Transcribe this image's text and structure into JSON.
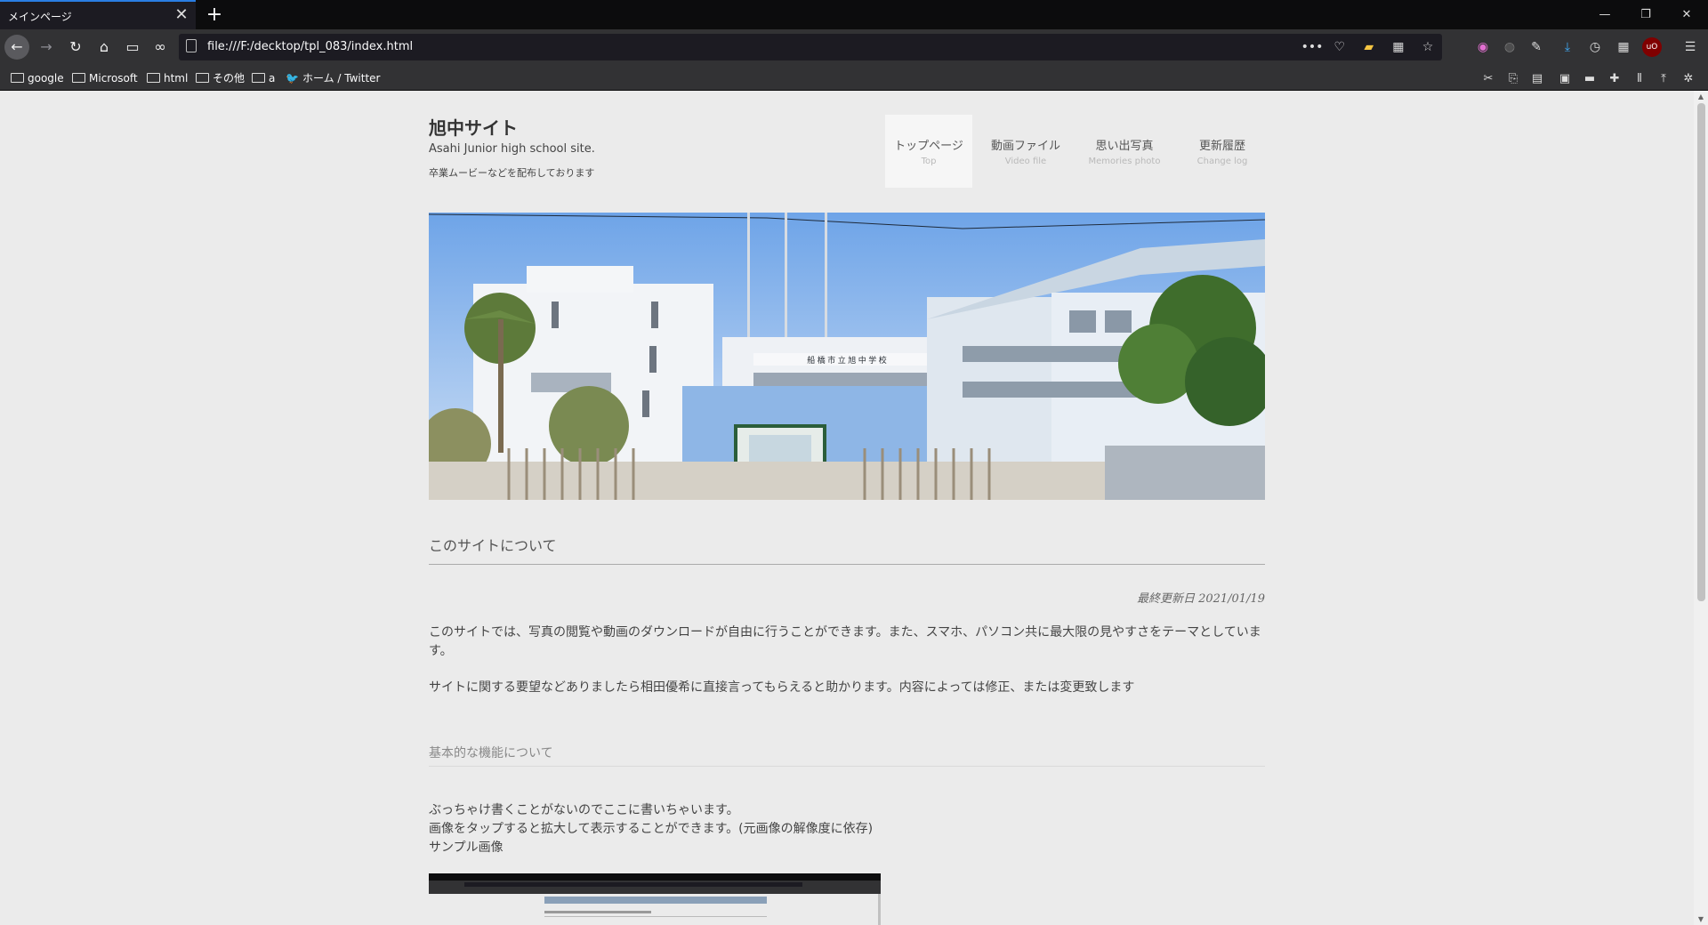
{
  "browser": {
    "tab_title": "メインページ",
    "tab_close": "✕",
    "new_tab": "+",
    "window_controls": {
      "minimize": "—",
      "restore": "❐",
      "close": "✕"
    },
    "url": "file:///F:/decktop/tpl_083/index.html",
    "nav": {
      "back": "←",
      "forward": "→",
      "reload": "↻",
      "home": "⌂",
      "reader": "▭",
      "mask": "∞"
    },
    "url_icons": [
      "•••",
      "♡",
      "▰",
      "▦",
      "☆"
    ],
    "extensions": [
      "◉",
      "◍",
      "✎",
      "⤓",
      "◷",
      "▦",
      "uO",
      "☰"
    ],
    "bookmarks": [
      {
        "label": "google",
        "icon": "folder-icon"
      },
      {
        "label": "Microsoft",
        "icon": "folder-icon"
      },
      {
        "label": "html",
        "icon": "folder-icon"
      },
      {
        "label": "その他",
        "icon": "folder-icon"
      },
      {
        "label": "a",
        "icon": "folder-icon"
      },
      {
        "label": "ホーム / Twitter",
        "icon": "twitter-icon"
      }
    ],
    "tools": [
      "✂",
      "⎘",
      "▤",
      "▣",
      "▬",
      "✚",
      "⫴",
      "⤒",
      "✲"
    ],
    "colors": {
      "tab_accent": "#2a7ee3",
      "toolbar": "#323234",
      "urlbar": "#1c1b22"
    }
  },
  "site": {
    "title": "旭中サイト",
    "subtitle": "Asahi Junior high school site.",
    "description": "卒業ムービーなどを配布しております",
    "nav": [
      {
        "ja": "トップページ",
        "en": "Top",
        "active": true
      },
      {
        "ja": "動画ファイル",
        "en": "Video file",
        "active": false
      },
      {
        "ja": "思い出写真",
        "en": "Memories photo",
        "active": false
      },
      {
        "ja": "更新履歴",
        "en": "Change log",
        "active": false
      }
    ],
    "hero_sign": "船 橋 市 立 旭 中 学 校"
  },
  "content": {
    "about_heading": "このサイトについて",
    "updated": "最終更新日 2021/01/19",
    "para1": "このサイトでは、写真の閲覧や動画のダウンロードが自由に行うことができます。また、スマホ、パソコン共に最大限の見やすさをテーマとしています。",
    "para2": "サイトに関する要望などありましたら相田優希に直接言ってもらえると助かります。内容によっては修正、または変更致します",
    "features_heading": "基本的な機能について",
    "features_line1": "ぶっちゃけ書くことがないのでここに書いちゃいます。",
    "features_line2": "画像をタップすると拡大して表示することができます。(元画像の解像度に依存)",
    "features_line3": "サンプル画像"
  }
}
